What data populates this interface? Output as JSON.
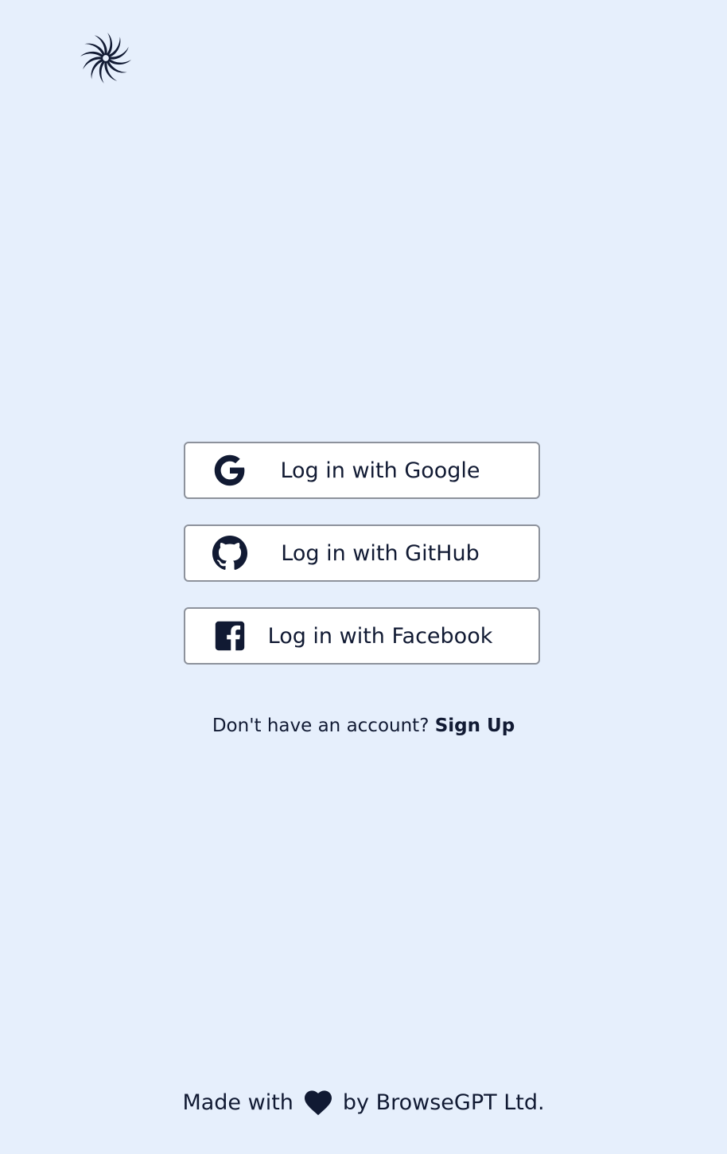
{
  "colors": {
    "background": "#e6effc",
    "text": "#111a33",
    "button_bg": "#ffffff",
    "button_border": "#8d929c"
  },
  "logo": {
    "icon": "spiral-logo-icon"
  },
  "login": {
    "google": {
      "label": "Log in with Google",
      "icon": "google-icon"
    },
    "github": {
      "label": "Log in with GitHub",
      "icon": "github-icon"
    },
    "facebook": {
      "label": "Log in with Facebook",
      "icon": "facebook-icon"
    }
  },
  "signup": {
    "prompt": "Don't have an account?",
    "link": "Sign Up"
  },
  "footer": {
    "made_with": "Made with",
    "heart_icon": "heart-icon",
    "by": "by BrowseGPT Ltd."
  }
}
